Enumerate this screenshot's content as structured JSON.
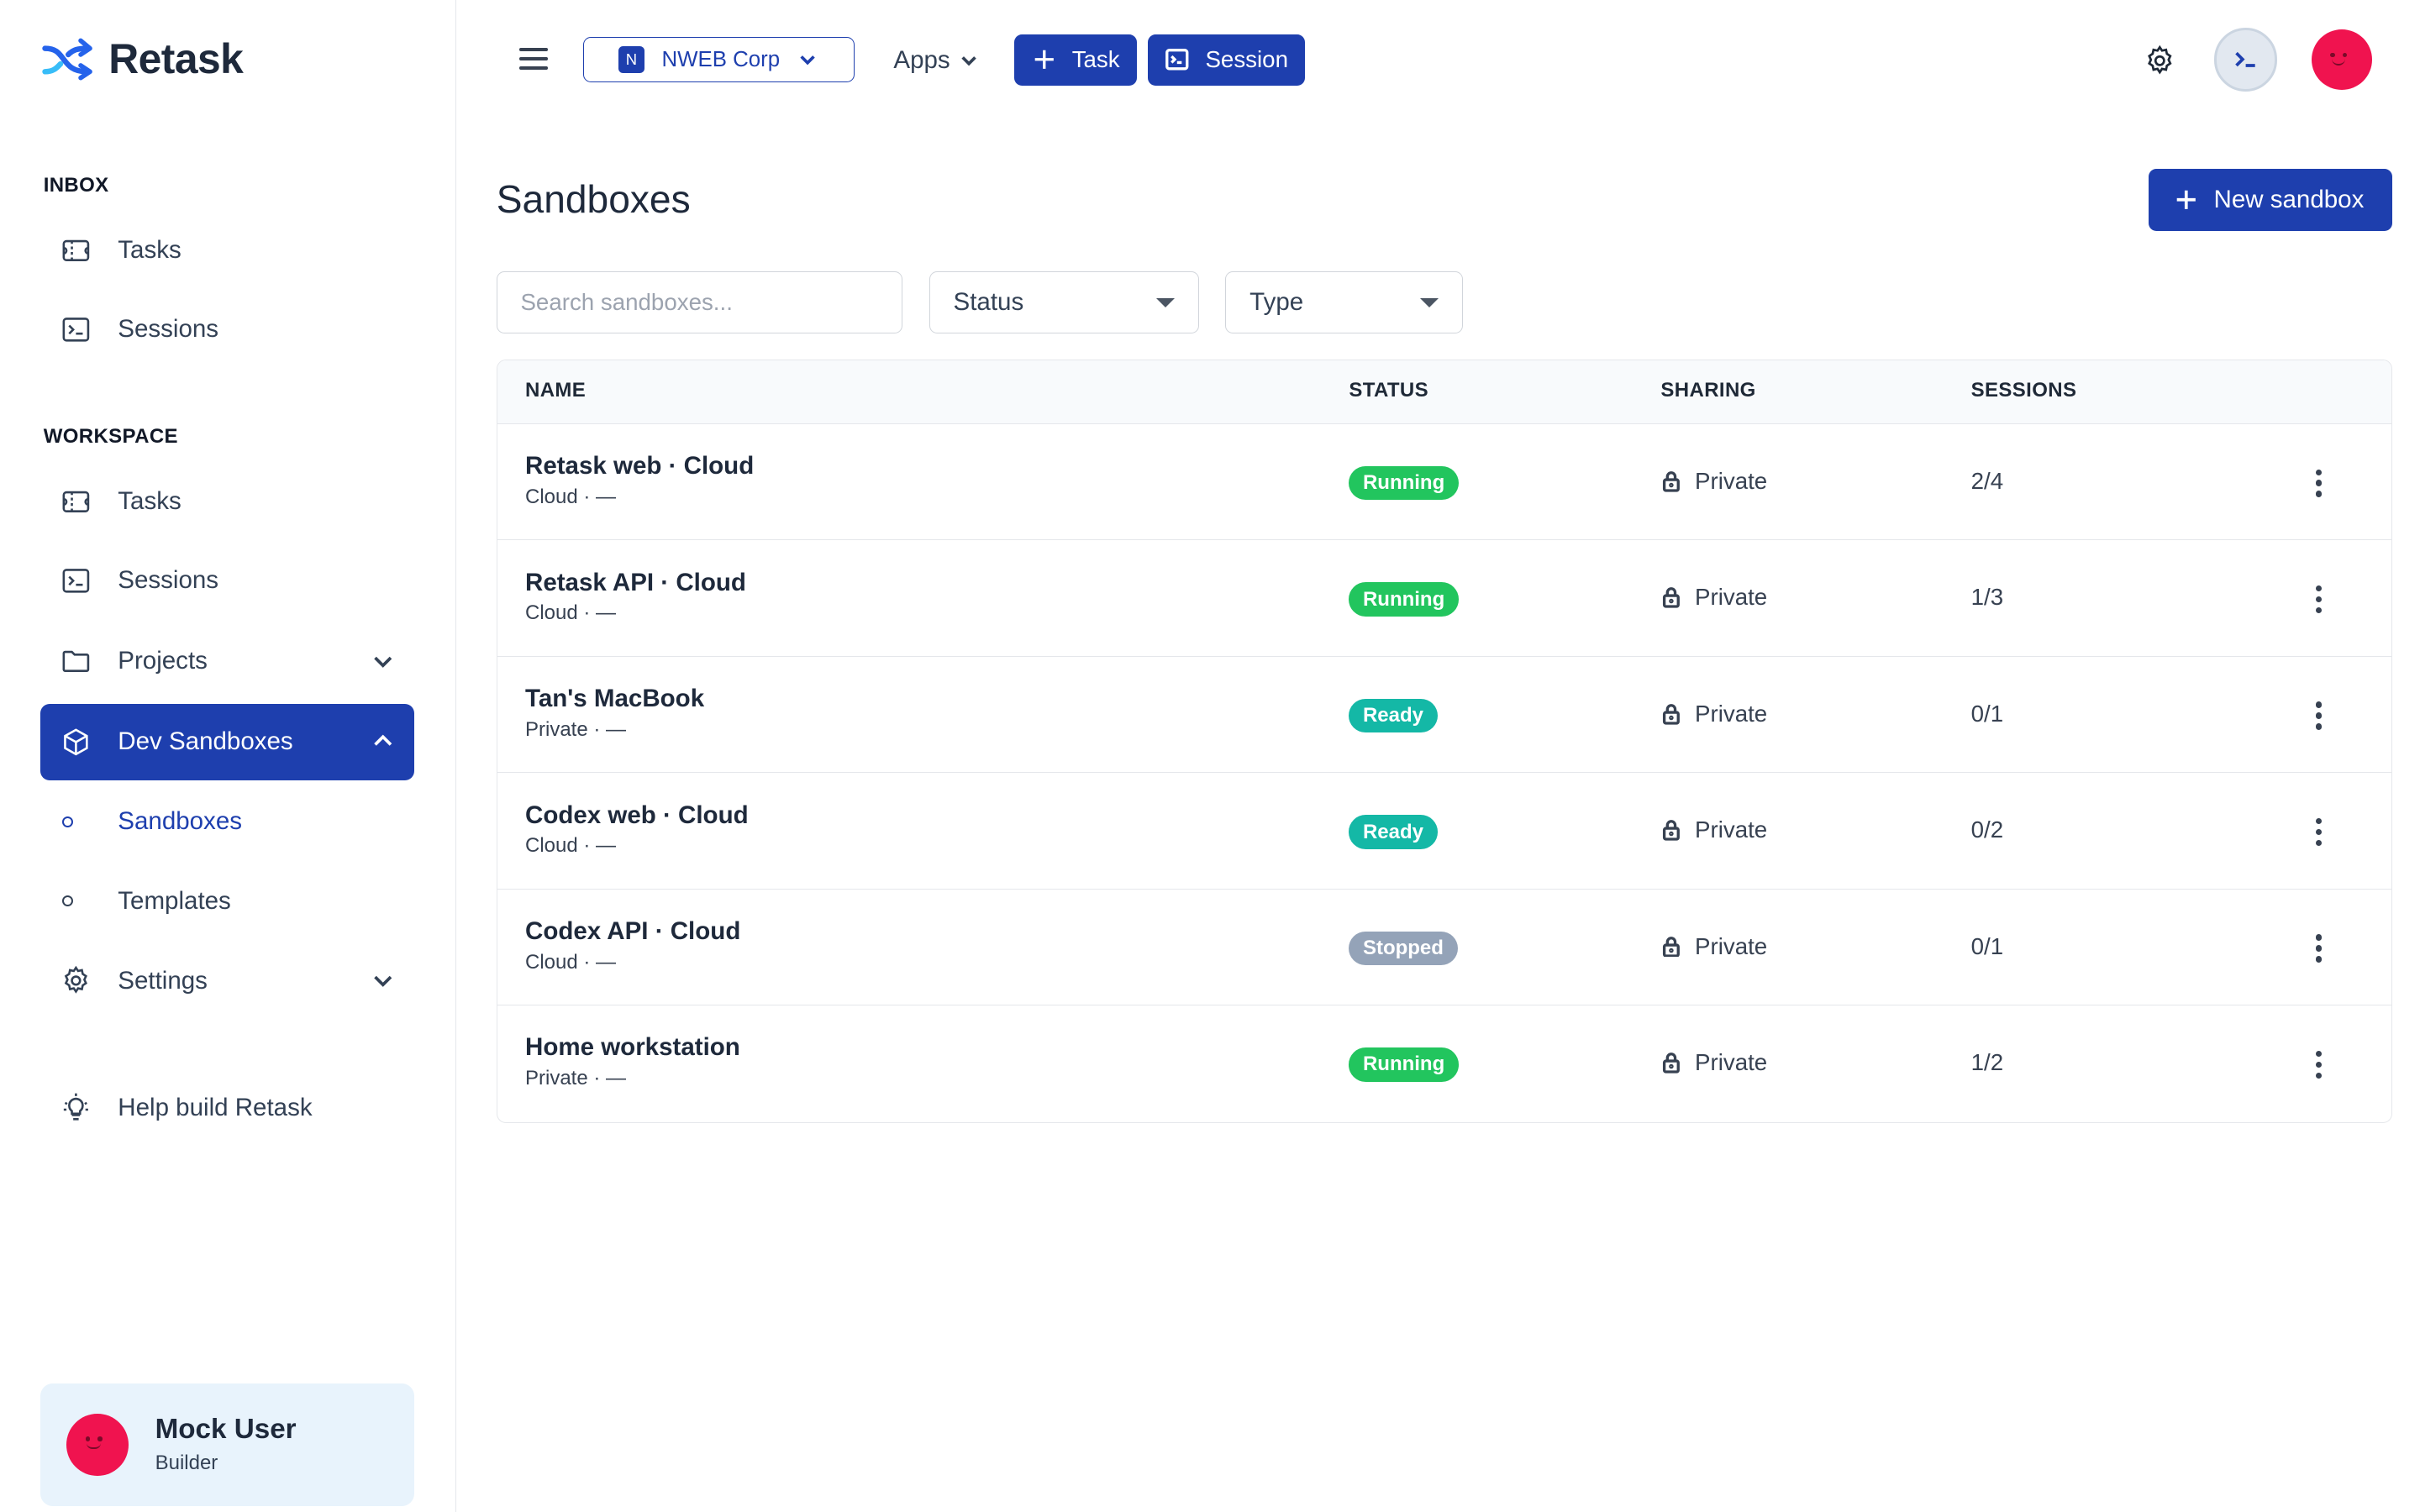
{
  "app": {
    "name": "Retask"
  },
  "sidebar": {
    "inbox_label": "INBOX",
    "inbox_items": [
      {
        "label": "Tasks",
        "icon": "ticket-icon"
      },
      {
        "label": "Sessions",
        "icon": "terminal-icon"
      }
    ],
    "workspace_label": "WORKSPACE",
    "workspace_items": [
      {
        "label": "Tasks",
        "icon": "ticket-icon"
      },
      {
        "label": "Sessions",
        "icon": "terminal-icon"
      },
      {
        "label": "Projects",
        "icon": "folder-icon",
        "expandable": true
      },
      {
        "label": "Dev Sandboxes",
        "icon": "cube-icon",
        "expanded": true,
        "active": true
      },
      {
        "label": "Sandboxes",
        "sub": true,
        "selected": true
      },
      {
        "label": "Templates",
        "sub": true
      },
      {
        "label": "Settings",
        "icon": "gear-icon",
        "expandable": true
      }
    ],
    "help_label": "Help build Retask",
    "user": {
      "name": "Mock User",
      "role": "Builder"
    }
  },
  "topbar": {
    "org_badge": "N",
    "org_name": "NWEB Corp",
    "apps_label": "Apps",
    "task_button": "Task",
    "session_button": "Session"
  },
  "main": {
    "title": "Sandboxes",
    "new_button": "New sandbox",
    "search_placeholder": "Search sandboxes...",
    "status_filter": "Status",
    "type_filter": "Type",
    "columns": [
      "NAME",
      "STATUS",
      "SHARING",
      "SESSIONS"
    ],
    "rows": [
      {
        "name": "Retask web · Cloud",
        "sub": "Cloud · —",
        "status": "Running",
        "sharing": "Private",
        "sessions": "2/4"
      },
      {
        "name": "Retask API · Cloud",
        "sub": "Cloud · —",
        "status": "Running",
        "sharing": "Private",
        "sessions": "1/3"
      },
      {
        "name": "Tan's MacBook",
        "sub": "Private · —",
        "status": "Ready",
        "sharing": "Private",
        "sessions": "0/1"
      },
      {
        "name": "Codex web · Cloud",
        "sub": "Cloud · —",
        "status": "Ready",
        "sharing": "Private",
        "sessions": "0/2"
      },
      {
        "name": "Codex API · Cloud",
        "sub": "Cloud · —",
        "status": "Stopped",
        "sharing": "Private",
        "sessions": "0/1"
      },
      {
        "name": "Home workstation",
        "sub": "Private · —",
        "status": "Running",
        "sharing": "Private",
        "sessions": "1/2"
      }
    ]
  },
  "colors": {
    "accent": "#1e3fae",
    "running": "#22c55e",
    "ready": "#14b8a6",
    "stopped": "#94a3b8",
    "avatar": "#f0134f",
    "user_card_bg": "#e8f3fc"
  }
}
